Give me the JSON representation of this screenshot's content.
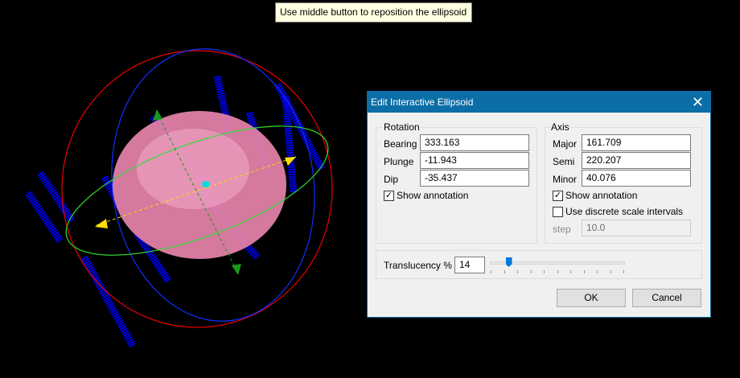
{
  "tooltip": "Use middle button to reposition the ellipsoid",
  "dialog": {
    "title": "Edit Interactive Ellipsoid",
    "rotation": {
      "label": "Rotation",
      "bearing_label": "Bearing",
      "bearing": "333.163",
      "plunge_label": "Plunge",
      "plunge": "-11.943",
      "dip_label": "Dip",
      "dip": "-35.437",
      "show_annotation": "Show annotation",
      "show_annotation_checked": true
    },
    "axis": {
      "label": "Axis",
      "major_label": "Major",
      "major": "161.709",
      "semi_label": "Semi",
      "semi": "220.207",
      "minor_label": "Minor",
      "minor": "40.076",
      "show_annotation": "Show annotation",
      "show_annotation_checked": true,
      "discrete": "Use discrete scale intervals",
      "discrete_checked": false,
      "step_label": "step",
      "step": "10.0"
    },
    "translucency": {
      "label": "Translucency %",
      "value": "14",
      "slider_percent": 14
    },
    "ok": "OK",
    "cancel": "Cancel"
  },
  "colors": {
    "ellipsoid": "#e07fa8",
    "trace": "#0000ee",
    "accent": "#0c6ea6"
  }
}
